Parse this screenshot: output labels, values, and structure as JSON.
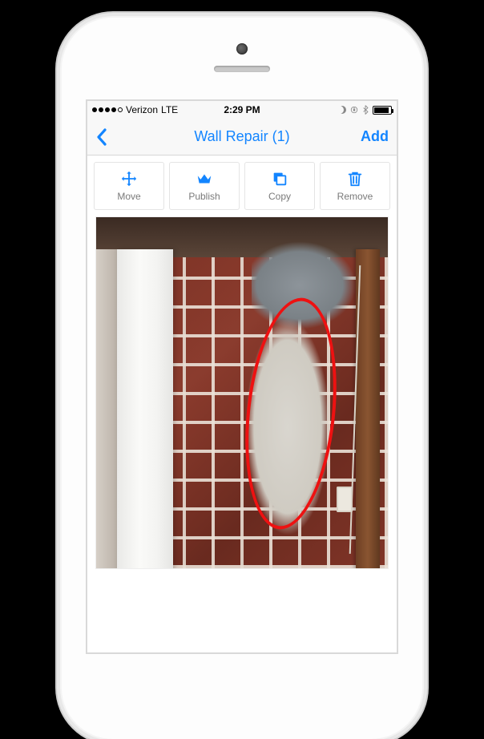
{
  "statusbar": {
    "carrier": "Verizon",
    "network": "LTE",
    "time": "2:29 PM",
    "signal_filled": 4,
    "signal_total": 5
  },
  "navbar": {
    "title": "Wall Repair (1)",
    "add_label": "Add"
  },
  "toolbar": {
    "move_label": "Move",
    "publish_label": "Publish",
    "copy_label": "Copy",
    "remove_label": "Remove"
  },
  "photo": {
    "description": "Brick wall with white plaster patch and grey mortar damage, circled in red",
    "annotation_color": "#e11"
  }
}
